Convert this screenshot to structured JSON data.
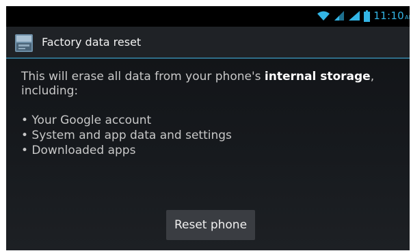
{
  "status_bar": {
    "time": "11:10",
    "time_suffix": "AM",
    "icons": [
      "wifi-icon",
      "signal-icon",
      "signal-icon",
      "battery-icon"
    ],
    "accent_color": "#33b5e5"
  },
  "title_bar": {
    "title": "Factory data reset",
    "icon": "settings-app-icon"
  },
  "content": {
    "intro_before": "This will erase all data from your phone's ",
    "intro_bold": "internal storage",
    "intro_after": ", including:",
    "items": [
      "• Your Google account",
      "• System and app data and settings",
      "• Downloaded apps"
    ]
  },
  "actions": {
    "reset_label": "Reset phone"
  }
}
